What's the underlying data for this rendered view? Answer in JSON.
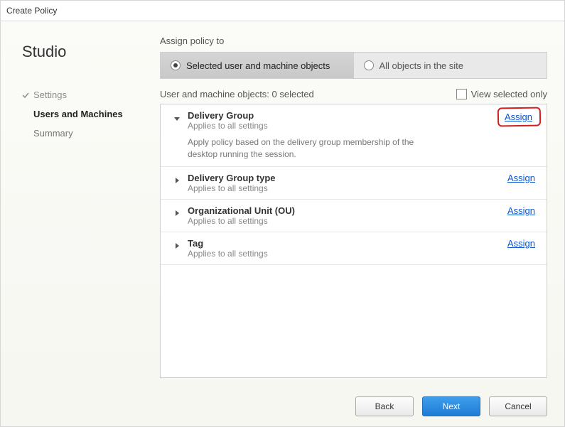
{
  "window": {
    "title": "Create Policy"
  },
  "sidebar": {
    "brand": "Studio",
    "steps": [
      {
        "label": "Settings",
        "state": "done"
      },
      {
        "label": "Users and Machines",
        "state": "active"
      },
      {
        "label": "Summary",
        "state": "future"
      }
    ]
  },
  "assign": {
    "section_label": "Assign policy to",
    "tabs": {
      "selected_label": "Selected user and machine objects",
      "all_label": "All objects in the site",
      "active_index": 0
    },
    "subheader": "User and machine objects: 0 selected",
    "view_selected_only_label": "View selected only",
    "view_selected_only_checked": false,
    "assign_link_label": "Assign",
    "items": [
      {
        "title": "Delivery Group",
        "subtitle": "Applies to all settings",
        "expanded": true,
        "annotated": true,
        "description": "Apply policy based on the delivery group membership of the desktop running the session."
      },
      {
        "title": "Delivery Group type",
        "subtitle": "Applies to all settings",
        "expanded": false,
        "annotated": false
      },
      {
        "title": "Organizational Unit (OU)",
        "subtitle": "Applies to all settings",
        "expanded": false,
        "annotated": false
      },
      {
        "title": "Tag",
        "subtitle": "Applies to all settings",
        "expanded": false,
        "annotated": false
      }
    ]
  },
  "footer": {
    "back": "Back",
    "next": "Next",
    "cancel": "Cancel"
  }
}
